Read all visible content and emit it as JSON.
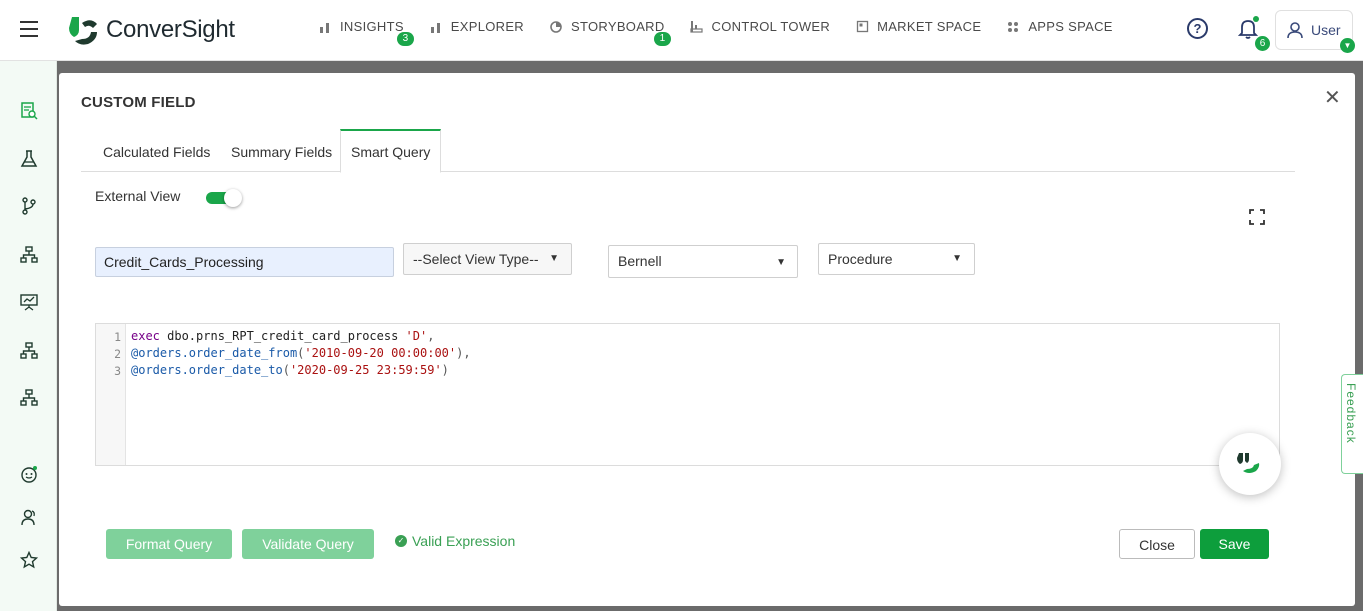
{
  "app": {
    "brand": "ConverSight"
  },
  "nav": {
    "items": [
      {
        "label": "INSIGHTS",
        "icon": "bar-chart-icon",
        "badge": "3"
      },
      {
        "label": "EXPLORER",
        "icon": "bar-chart-icon",
        "badge": ""
      },
      {
        "label": "STORYBOARD",
        "icon": "pie-chart-icon",
        "badge": "1"
      },
      {
        "label": "CONTROL TOWER",
        "icon": "tower-icon",
        "badge": ""
      },
      {
        "label": "MARKET SPACE",
        "icon": "market-icon",
        "badge": ""
      },
      {
        "label": "APPS SPACE",
        "icon": "apps-grid-icon",
        "badge": ""
      }
    ],
    "notification_count": "6",
    "user_label": "User"
  },
  "sidebar": {
    "icons": [
      "report-search-icon",
      "flask-icon",
      "branch-icon",
      "hierarchy-icon",
      "presentation-icon",
      "hierarchy-icon",
      "hierarchy-icon",
      "bot-icon",
      "users-icon",
      "star-icon"
    ]
  },
  "modal": {
    "title": "CUSTOM FIELD",
    "tabs": [
      {
        "label": "Calculated Fields",
        "active": false
      },
      {
        "label": "Summary Fields",
        "active": false
      },
      {
        "label": "Smart Query",
        "active": true
      }
    ],
    "external_view_label": "External View",
    "external_view_enabled": true,
    "field_name_value": "Credit_Cards_Processing",
    "view_type_select": "--Select View Type--",
    "source_select": "Bernell",
    "object_type_select": "Procedure",
    "code_lines": [
      "exec dbo.prns_RPT_credit_card_process 'D',",
      "@orders.order_date_from('2010-09-20 00:00:00'),",
      "@orders.order_date_to('2020-09-25 23:59:59')"
    ],
    "line_numbers": [
      "1",
      "2",
      "3"
    ],
    "format_query_label": "Format Query",
    "validate_query_label": "Validate Query",
    "validation_message": "Valid Expression",
    "close_label": "Close",
    "save_label": "Save"
  },
  "feedback_label": "Feedback",
  "colors": {
    "accent": "#1aa64a",
    "save": "#0d9e3c",
    "disabled_button": "#7fd19b",
    "input_bg": "#e8f0fe"
  }
}
